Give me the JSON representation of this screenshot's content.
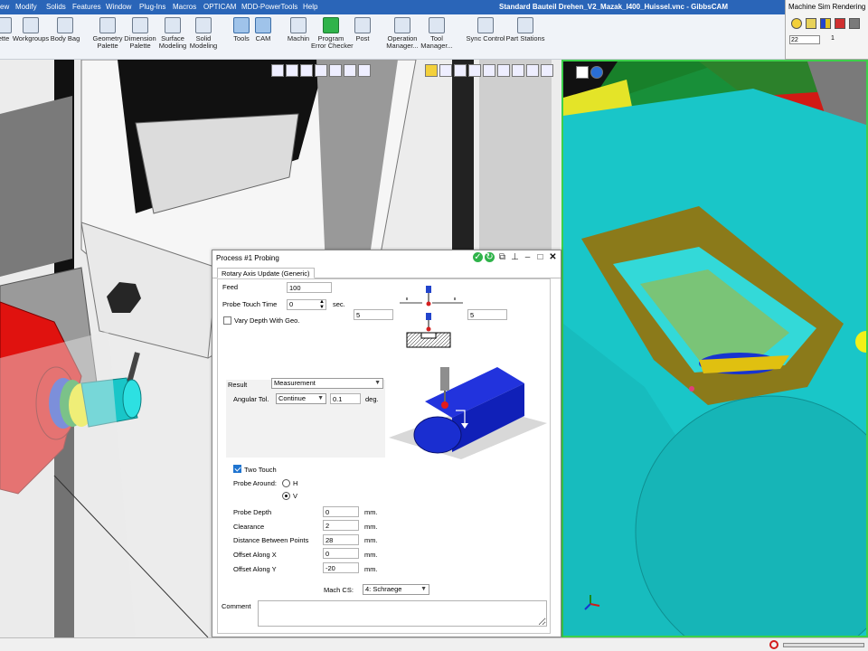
{
  "menubar": {
    "items": [
      "ew",
      "Modify",
      "Solids",
      "Features",
      "Window",
      "Plug-Ins",
      "Macros",
      "OPTICAM",
      "MDD-PowerTools",
      "Help"
    ],
    "window_title": "Standard Bauteil Drehen_V2_Mazak_I400_Huissel.vnc - GibbsCAM",
    "bg_color": "#2a65b8"
  },
  "ribbon": {
    "buttons": [
      {
        "label": "ette",
        "icon": "palette-icon"
      },
      {
        "label": "Workgroups",
        "icon": "workgroups-icon"
      },
      {
        "label": "Body Bag",
        "icon": "body-bag-icon"
      },
      {
        "label": "Geometry\nPalette",
        "icon": "geometry-palette-icon"
      },
      {
        "label": "Dimension\nPalette",
        "icon": "dimension-palette-icon"
      },
      {
        "label": "Surface\nModeling",
        "icon": "surface-modeling-icon"
      },
      {
        "label": "Solid\nModeling",
        "icon": "solid-modeling-icon"
      },
      {
        "label": "Tools",
        "icon": "tools-icon"
      },
      {
        "label": "CAM",
        "icon": "cam-icon"
      },
      {
        "label": "Machin",
        "icon": "machine-icon"
      },
      {
        "label": "Program\nError Checker",
        "icon": "error-checker-icon"
      },
      {
        "label": "Post",
        "icon": "post-icon"
      },
      {
        "label": "Operation\nManager...",
        "icon": "operation-manager-icon"
      },
      {
        "label": "Tool\nManager...",
        "icon": "tool-manager-icon"
      },
      {
        "label": "Sync Control",
        "icon": "sync-control-icon"
      },
      {
        "label": "Part Stations",
        "icon": "part-stations-icon"
      }
    ]
  },
  "machine_sim": {
    "title": "Machine Sim Rendering",
    "input_value": "22",
    "sub_value": "1"
  },
  "dialog": {
    "title": "Process #1 Probing",
    "tab": "Rotary Axis Update (Generic)",
    "feed_label": "Feed",
    "feed_value": "100",
    "touch_time_label": "Probe Touch Time",
    "touch_time_value": "0",
    "touch_time_unit": "sec.",
    "vary_depth_label": "Vary Depth With Geo.",
    "vary_depth_checked": false,
    "depth_left_value": "5",
    "depth_right_value": "5",
    "result_label": "Result",
    "result_value": "Measurement",
    "angular_tol_label": "Angular Tol.",
    "angular_tol_mode": "Continue",
    "angular_tol_value": "0.1",
    "angular_tol_unit": "deg.",
    "two_touch_label": "Two Touch",
    "two_touch_checked": true,
    "probe_around_label": "Probe Around:",
    "probe_around_options": [
      "H",
      "V"
    ],
    "probe_around_selected": "V",
    "probe_depth_label": "Probe Depth",
    "probe_depth_value": "0",
    "clearance_label": "Clearance",
    "clearance_value": "2",
    "distance_label": "Distance Between Points",
    "distance_value": "28",
    "offset_x_label": "Offset Along X",
    "offset_x_value": "0",
    "offset_y_label": "Offset Along Y",
    "offset_y_value": "-20",
    "mm_unit": "mm.",
    "mach_cs_label": "Mach CS:",
    "mach_cs_value": "4: Schraege",
    "comment_label": "Comment"
  },
  "status": {
    "progress": 0.0
  },
  "colors": {
    "cyan_part": "#19c6c8",
    "olive_face": "#8b7a1a",
    "chuck_red": "#e0120f",
    "viewport_border": "#3cd04a"
  }
}
